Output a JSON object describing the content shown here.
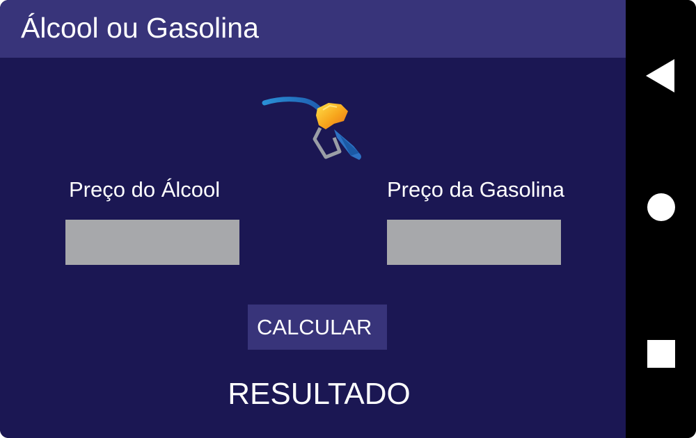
{
  "app": {
    "title": "Álcool ou Gasolina"
  },
  "form": {
    "alcool_label": "Preço do Álcool",
    "alcool_value": "",
    "gasolina_label": "Preço da Gasolina",
    "gasolina_value": ""
  },
  "actions": {
    "calculate_label": "CALCULAR"
  },
  "result": {
    "text": "RESULTADO"
  },
  "icons": {
    "header_icon": "fuel-nozzle-icon",
    "nav_back": "back-triangle-icon",
    "nav_home": "home-circle-icon",
    "nav_recent": "recent-apps-square-icon"
  },
  "colors": {
    "background": "#1b1753",
    "app_bar": "#38347a",
    "button": "#38347a",
    "input": "#a7a8ab",
    "text": "#ffffff",
    "nav_bar": "#000000"
  }
}
